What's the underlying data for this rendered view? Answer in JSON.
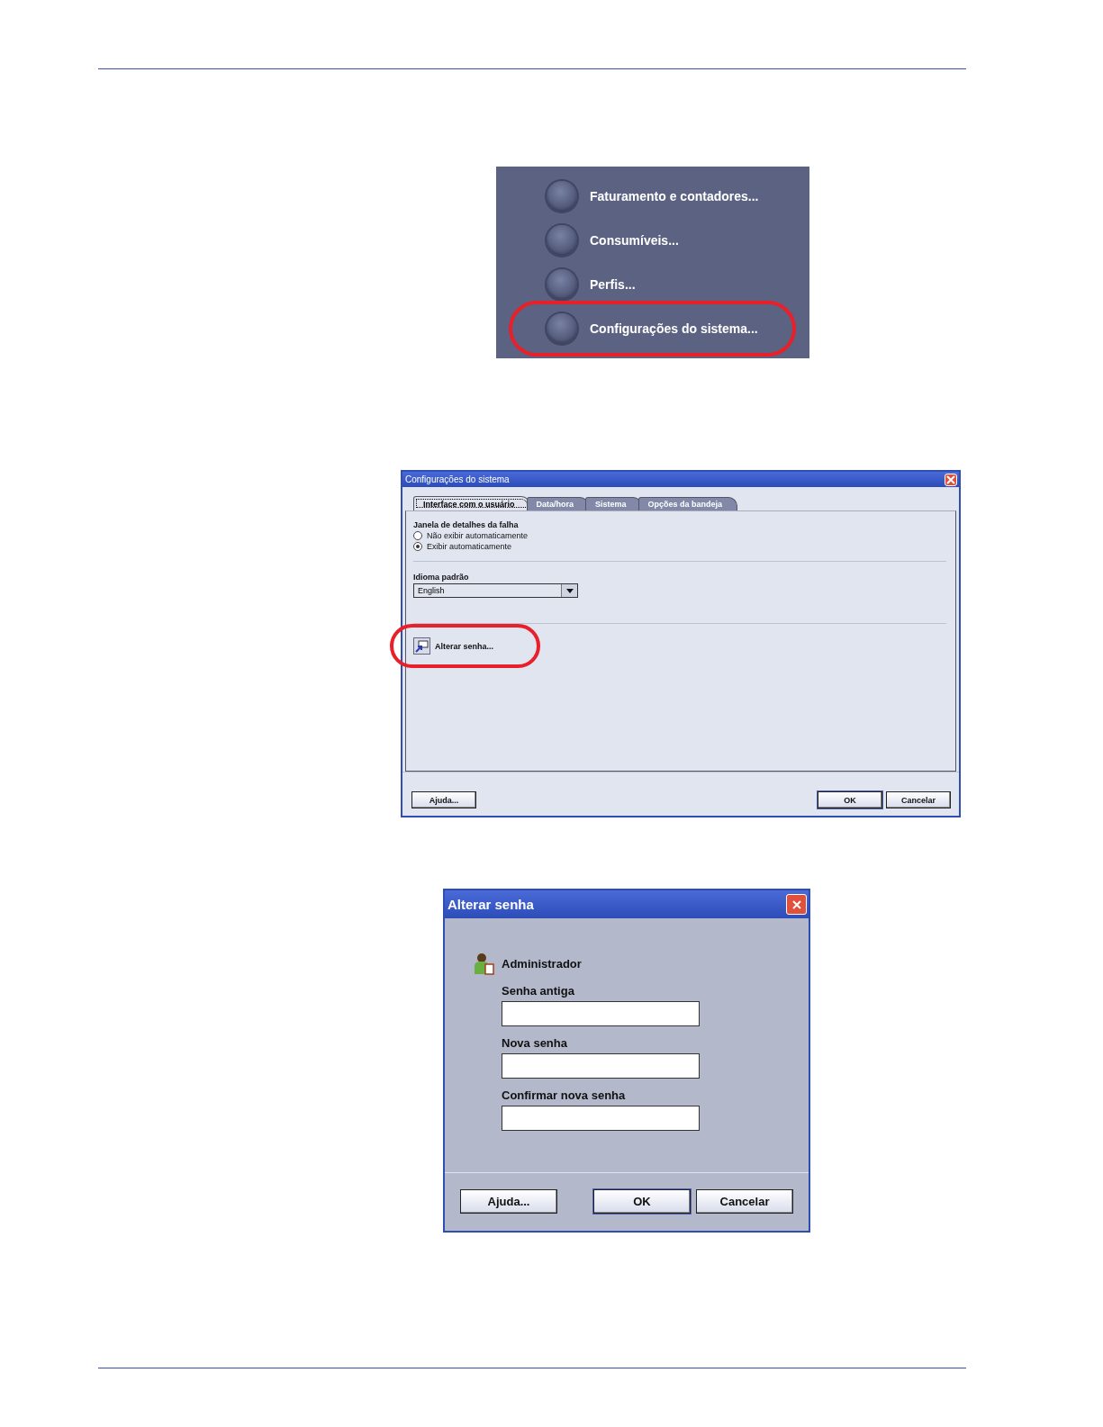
{
  "menu": {
    "items": [
      {
        "label": "Faturamento e contadores...",
        "highlighted": false
      },
      {
        "label": "Consumíveis...",
        "highlighted": false
      },
      {
        "label": "Perfis...",
        "highlighted": false
      },
      {
        "label": "Configurações do sistema...",
        "highlighted": true
      }
    ]
  },
  "settings_dialog": {
    "title": "Configurações do sistema",
    "tabs": [
      {
        "label": "Interface com o usuário",
        "selected": true
      },
      {
        "label": "Data/hora",
        "selected": false
      },
      {
        "label": "Sistema",
        "selected": false
      },
      {
        "label": "Opções da bandeja",
        "selected": false
      }
    ],
    "fault_window": {
      "label": "Janela de detalhes da falha",
      "options": [
        {
          "label": "Não exibir automaticamente",
          "selected": false
        },
        {
          "label": "Exibir automaticamente",
          "selected": true
        }
      ]
    },
    "language": {
      "label": "Idioma padrão",
      "value": "English"
    },
    "change_password": {
      "label": "Alterar senha...",
      "highlighted": true
    },
    "buttons": {
      "help": "Ajuda...",
      "ok": "OK",
      "cancel": "Cancelar"
    }
  },
  "password_dialog": {
    "title": "Alterar senha",
    "user": "Administrador",
    "fields": [
      {
        "label": "Senha antiga"
      },
      {
        "label": "Nova senha"
      },
      {
        "label": "Confirmar nova senha"
      }
    ],
    "buttons": {
      "help": "Ajuda...",
      "ok": "OK",
      "cancel": "Cancelar"
    }
  }
}
